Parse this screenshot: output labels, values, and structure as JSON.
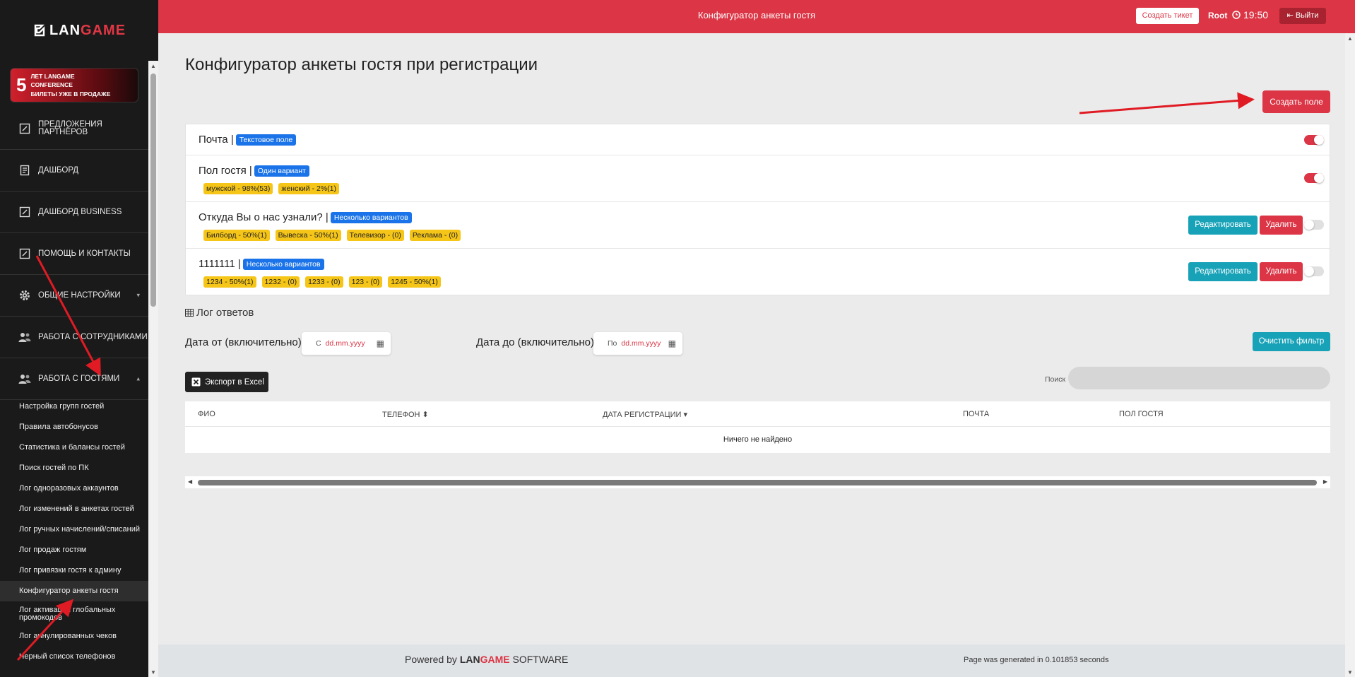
{
  "brand": {
    "lan": "LAN",
    "game": "GAME"
  },
  "banner": {
    "big": "5",
    "line1": "ЛЕТ LANGAME",
    "line2": "CONFERENCE",
    "line3": "БИЛЕТЫ УЖЕ В ПРОДАЖЕ"
  },
  "menu": [
    {
      "label": "Предложения партнёров",
      "icon": "edit-icon"
    },
    {
      "label": "Дашборд",
      "icon": "document-icon"
    },
    {
      "label": "Дашборд Business",
      "icon": "edit-icon"
    },
    {
      "label": "Помощь и контакты",
      "icon": "edit-icon"
    },
    {
      "label": "Общие настройки",
      "icon": "gear-icon"
    },
    {
      "label": "Работа с сотрудниками",
      "icon": "users-icon"
    },
    {
      "label": "Работа с гостями",
      "icon": "users-icon"
    }
  ],
  "submenu": [
    "Настройка групп гостей",
    "Правила автобонусов",
    "Статистика и балансы гостей",
    "Поиск гостей по ПК",
    "Лог одноразовых аккаунтов",
    "Лог изменений в анкетах гостей",
    "Лог ручных начислений/списаний",
    "Лог продаж гостям",
    "Лог привязки гостя к админу",
    "Конфигуратор анкеты гостя",
    "Лог активации глобальных промокодов",
    "Лог аннулированных чеков",
    "Черный список телефонов"
  ],
  "topbar": {
    "title": "Конфигуратор анкеты гостя",
    "ticket": "Создать тикет",
    "user": "Root",
    "time": "19:50",
    "logout": "Выйти"
  },
  "page": {
    "title": "Конфигуратор анкеты гостя при регистрации",
    "create_field": "Создать поле"
  },
  "fields": [
    {
      "name": "Почта |",
      "type": "Текстовое поле",
      "options": [],
      "enabled": true,
      "editable": false
    },
    {
      "name": "Пол гостя |",
      "type": "Один вариант",
      "options": [
        "мужской - 98%(53)",
        "женский - 2%(1)"
      ],
      "enabled": true,
      "editable": false
    },
    {
      "name": "Откуда Вы о нас узнали? |",
      "type": "Несколько вариантов",
      "options": [
        "Билборд - 50%(1)",
        "Вывеска - 50%(1)",
        "Телевизор - (0)",
        "Реклама - (0)"
      ],
      "enabled": false,
      "editable": true
    },
    {
      "name": "1111111 |",
      "type": "Несколько вариантов",
      "options": [
        "1234 - 50%(1)",
        "1232 - (0)",
        "1233 - (0)",
        "123 - (0)",
        "1245 - 50%(1)"
      ],
      "enabled": false,
      "editable": true
    }
  ],
  "actions": {
    "edit": "Редактировать",
    "delete": "Удалить"
  },
  "log": {
    "title": "Лог ответов",
    "date_from_label": "Дата от (включительно)",
    "date_from_prefix": "С",
    "date_to_label": "Дата до (включительно)",
    "date_to_prefix": "По",
    "date_placeholder": "dd.mm.yyyy",
    "clear_filter": "Очистить фильтр",
    "export": "Экспорт в Excel",
    "search_label": "Поиск",
    "columns": [
      "ФИО",
      "Телефон",
      "Дата регистрации",
      "Почта",
      "Пол гостя"
    ],
    "empty": "Ничего не найдено"
  },
  "footer": {
    "powered": "Powered by",
    "lan": "LAN",
    "game": "GAME",
    "software": "SOFTWARE",
    "generated": "Page was generated in 0.101853 seconds"
  },
  "colors": {
    "accent": "#dc3545",
    "info": "#17a2b8",
    "badge": "#1a73e8",
    "option": "#f5c518",
    "sidebar": "#1a1a1a"
  }
}
